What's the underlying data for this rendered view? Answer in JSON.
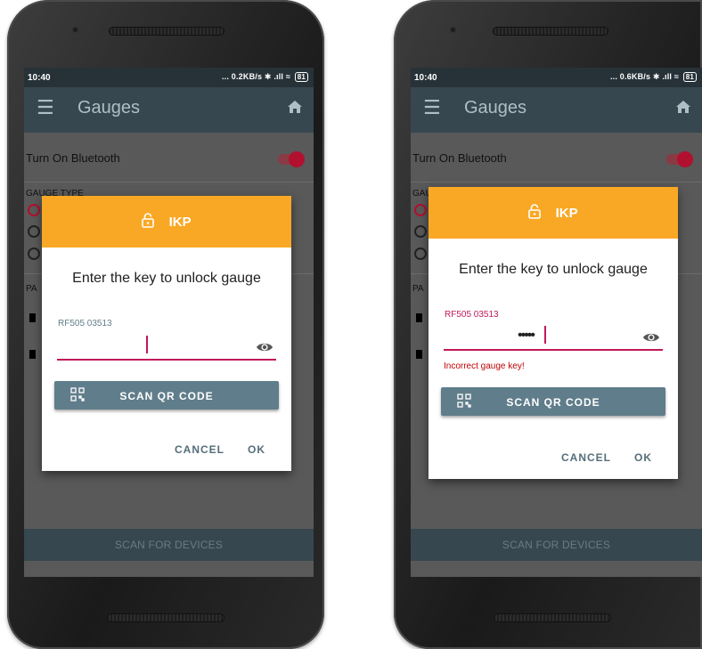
{
  "screens": [
    {
      "status_bar": {
        "time": "10:40",
        "network_speed": "... 0.2KB/s",
        "battery": "81"
      },
      "app_bar": {
        "title": "Gauges",
        "menu_icon": "hamburger-menu-icon",
        "home_icon": "home-icon"
      },
      "settings": {
        "bluetooth_label": "Turn On Bluetooth",
        "bluetooth_on": true,
        "gauge_type_label": "GAUGE TYPE",
        "paired_label": "PA"
      },
      "dialog": {
        "title": "IKP",
        "lock_icon": "lock-open-icon",
        "prompt": "Enter the key to unlock gauge",
        "field_label": "RF505 03513",
        "field_value": "",
        "error": "",
        "scan_qr_label": "SCAN QR CODE",
        "cancel_label": "CANCEL",
        "ok_label": "OK"
      },
      "scan_devices_label": "SCAN FOR DEVICES"
    },
    {
      "status_bar": {
        "time": "10:40",
        "network_speed": "... 0.6KB/s",
        "battery": "81"
      },
      "app_bar": {
        "title": "Gauges",
        "menu_icon": "hamburger-menu-icon",
        "home_icon": "home-icon"
      },
      "settings": {
        "bluetooth_label": "Turn On Bluetooth",
        "bluetooth_on": true,
        "gauge_type_label": "GAUGE TYPE",
        "paired_label": "PA"
      },
      "dialog": {
        "title": "IKP",
        "lock_icon": "lock-open-icon",
        "prompt": "Enter the key to unlock gauge",
        "field_label": "RF505 03513",
        "field_value": "•••••",
        "error": "Incorrect gauge key!",
        "scan_qr_label": "SCAN QR CODE",
        "cancel_label": "CANCEL",
        "ok_label": "OK"
      },
      "scan_devices_label": "SCAN FOR DEVICES"
    }
  ],
  "colors": {
    "header_orange": "#f9a825",
    "appbar": "#37474f",
    "accent_red": "#c2185b",
    "qr_button": "#607d8b",
    "error_red": "#c00000"
  }
}
